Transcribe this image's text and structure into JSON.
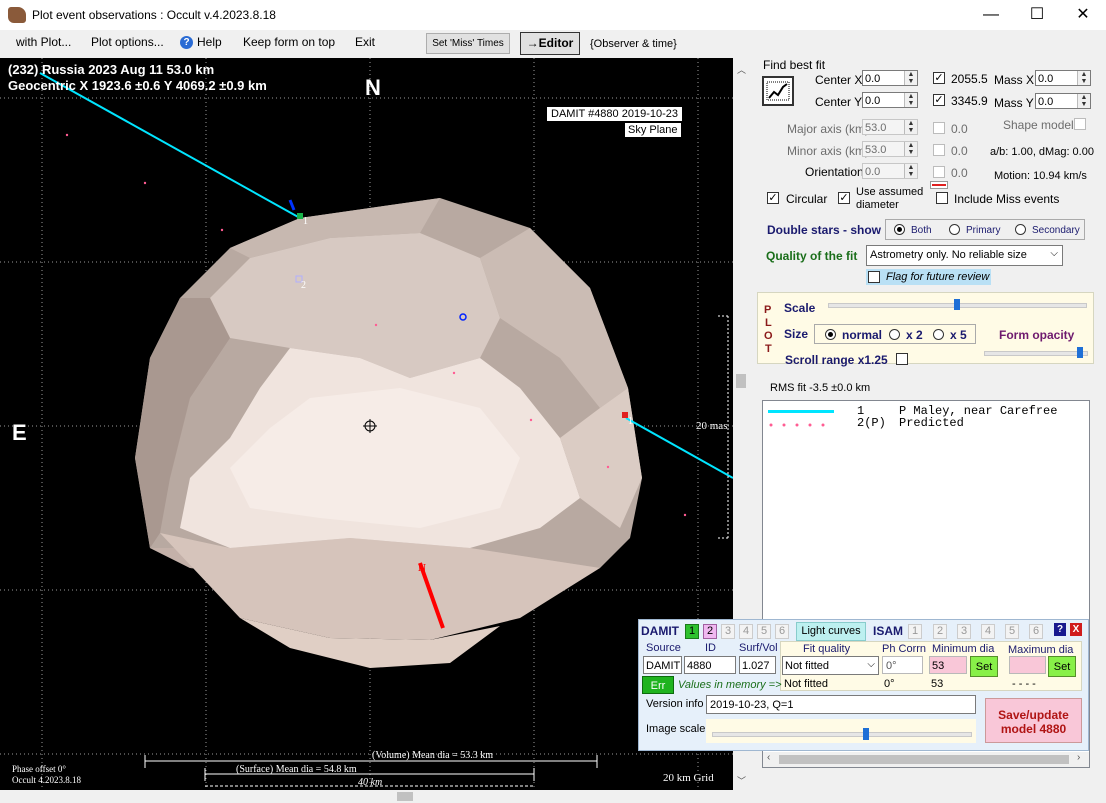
{
  "window": {
    "title": "Plot event observations : Occult v.4.2023.8.18",
    "minimize": "—",
    "maximize": "☐",
    "close": "✕"
  },
  "menu": {
    "with_plot": "with Plot...",
    "plot_options": "Plot options...",
    "help": "Help",
    "keep_on_top": "Keep form on top",
    "exit": "Exit",
    "set_miss": "Set 'Miss' Times",
    "editor": "→Editor",
    "observer_time": "{Observer & time}"
  },
  "plot": {
    "header_line1": "(232) Russia  2023 Aug 11   53.0 km",
    "header_line2": "Geocentric  X  1923.6 ±0.6  Y 4069.2 ±0.9 km",
    "north": "N",
    "east": "E",
    "damit_label": "DAMIT #4880 2019-10-23",
    "sky_plane": "Sky Plane",
    "chord1_label": "1",
    "chord1b_label": "1",
    "chord2_label": "2",
    "scale_label": "20 mas",
    "phase_offset": "Phase offset 0°",
    "version": "Occult 4.2023.8.18",
    "volume_mean": "(Volume) Mean dia = 53.3 km",
    "surface_mean": "(Surface) Mean dia = 54.8 km",
    "grid_bar": "40 km",
    "grid_label": "20 km Grid",
    "n_arrow": "N"
  },
  "fit": {
    "find_best_fit": "Find best fit",
    "center_x_label": "Center X",
    "center_x": "0.0",
    "center_y_label": "Center Y",
    "center_y": "0.0",
    "val_2055": "2055.5",
    "val_3345": "3345.9",
    "mass_x_label": "Mass X",
    "mass_x": "0.0",
    "mass_y_label": "Mass Y",
    "mass_y": "0.0",
    "major_label": "Major axis (km)",
    "major": "53.0",
    "minor_label": "Minor axis (km)",
    "minor": "53.0",
    "orient_label": "Orientation",
    "orient": "0.0",
    "zero1": "0.0",
    "zero2": "0.0",
    "zero3": "0.0",
    "shape_model": "Shape model",
    "ab_dmag": "a/b: 1.00, dMag: 0.00",
    "motion": "Motion: 10.94 km/s",
    "circular": "Circular",
    "use_assumed": "Use assumed",
    "diameter": "diameter",
    "include_miss": "Include Miss events",
    "double_stars": "Double stars - show",
    "both": "Both",
    "primary": "Primary",
    "secondary": "Secondary",
    "quality_label": "Quality of the fit",
    "quality_value": "Astrometry only. No reliable size",
    "flag_review": "Flag for future review"
  },
  "plotctl": {
    "p": "P",
    "l": "L",
    "o": "O",
    "t": "T",
    "scale": "Scale",
    "size": "Size",
    "normal": "normal",
    "x2": "x 2",
    "x5": "x 5",
    "form_opacity": "Form opacity",
    "scroll_range": "Scroll range x1.25",
    "scale_level": 0.5,
    "opacity_level": 0.97
  },
  "rms": "RMS fit -3.5 ±0.0 km",
  "legend": [
    {
      "num": "1",
      "text": "P Maley, near Carefree",
      "color": "#00e5ff"
    },
    {
      "num": "2(P)",
      "text": "Predicted",
      "color": "#ff5c93"
    }
  ],
  "damit": {
    "damit_label": "DAMIT",
    "d1": "1",
    "d2": "2",
    "d3": "3",
    "d4": "4",
    "d5": "5",
    "d6": "6",
    "light_curves": "Light curves",
    "isam_label": "ISAM",
    "i1": "1",
    "i2": "2",
    "i3": "3",
    "i4": "4",
    "i5": "5",
    "i6": "6",
    "help": "?",
    "close": "X",
    "source_h": "Source",
    "id_h": "ID",
    "surfvol_h": "Surf/Vol",
    "fitq_h": "Fit quality",
    "phcorr_h": "Ph Corrn",
    "mindia_h": "Minimum dia",
    "maxdia_h": "Maximum dia",
    "source": "DAMIT",
    "id": "4880",
    "surfvol": "1.027",
    "fitq": "Not fitted",
    "phcorr": "0°",
    "mindia": "53",
    "set": "Set",
    "set2": "Set",
    "err": "Err",
    "values_mem": "Values in memory =>",
    "mem_fitq": "Not fitted",
    "mem_ph": "0°",
    "mem_min": "53",
    "mem_max": "- - - -",
    "version_label": "Version info",
    "version_value": "2019-10-23, Q=1",
    "image_scale": "Image scale",
    "save_update": "Save/update",
    "save_model": "model 4880",
    "image_scale_level": 0.6
  }
}
